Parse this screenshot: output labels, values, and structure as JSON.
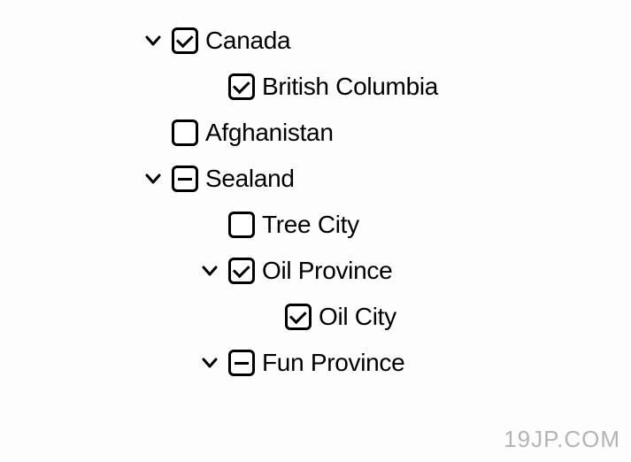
{
  "tree": [
    {
      "label": "Canada",
      "level": 0,
      "expanded": true,
      "state": "checked"
    },
    {
      "label": "British Columbia",
      "level": 1,
      "expanded": null,
      "state": "checked"
    },
    {
      "label": "Afghanistan",
      "level": 0,
      "expanded": null,
      "state": "unchecked"
    },
    {
      "label": "Sealand",
      "level": 0,
      "expanded": true,
      "state": "indeterminate"
    },
    {
      "label": "Tree City",
      "level": 1,
      "expanded": null,
      "state": "unchecked"
    },
    {
      "label": "Oil Province",
      "level": 1,
      "expanded": true,
      "state": "checked"
    },
    {
      "label": "Oil City",
      "level": 2,
      "expanded": null,
      "state": "checked"
    },
    {
      "label": "Fun Province",
      "level": 1,
      "expanded": true,
      "state": "indeterminate"
    }
  ],
  "watermark": "19JP.COM"
}
